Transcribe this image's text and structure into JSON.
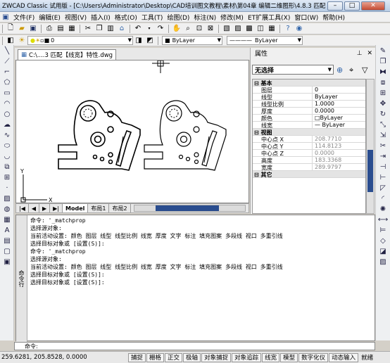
{
  "window": {
    "title": "ZWCAD Classic 试用版 - [C:\\Users\\Administrator\\Desktop\\CAD培训图文教程\\素材\\第04章 编辑二维图形\\4.8.3 匹配【线宽】特性.dwg]",
    "min": "–",
    "max": "□",
    "close": "✕"
  },
  "menu": [
    "文件(F)",
    "编辑(E)",
    "视图(V)",
    "插入(I)",
    "格式(O)",
    "工具(T)",
    "绘图(D)",
    "标注(N)",
    "修改(M)",
    "ET扩展工具(X)",
    "窗口(W)",
    "帮助(H)"
  ],
  "toolbar2": {
    "layer": "0",
    "color": "ByLayer",
    "linetype": "ByLayer"
  },
  "document": {
    "tab_label": "C:\\....3 匹配【线宽】特性.dwg",
    "layout_tabs": [
      "Model",
      "布局1",
      "布局2"
    ]
  },
  "properties": {
    "title": "属性",
    "pin": "⊥",
    "close": "✕",
    "selection": "无选择",
    "rows": [
      {
        "k": "基本",
        "v": "",
        "cat": true
      },
      {
        "k": "图层",
        "v": "0"
      },
      {
        "k": "线型",
        "v": "ByLayer"
      },
      {
        "k": "线型比例",
        "v": "1.0000"
      },
      {
        "k": "厚度",
        "v": "0.0000"
      },
      {
        "k": "颜色",
        "v": "□ByLayer"
      },
      {
        "k": "线宽",
        "v": "— ByLayer"
      },
      {
        "k": "视图",
        "v": "",
        "cat": true
      },
      {
        "k": "中心点 X",
        "v": "208.7710",
        "ro": true
      },
      {
        "k": "中心点 Y",
        "v": "114.8123",
        "ro": true
      },
      {
        "k": "中心点 Z",
        "v": "0.0000",
        "ro": true
      },
      {
        "k": "高度",
        "v": "183.3368",
        "ro": true
      },
      {
        "k": "宽度",
        "v": "289.9797",
        "ro": true
      },
      {
        "k": "其它",
        "v": "",
        "cat": true
      }
    ]
  },
  "command": {
    "side_label": "命令行",
    "lines": [
      "命令: '_matchprop",
      "选择源对象:",
      "当前活动设置: 颜色 图层 线型 线型比例 线宽 厚度 文字 标注 填充图案 多段线 视口 多重引线",
      "选择目标对象或 [设置(S)]:",
      "命令: '_matchprop",
      "选择源对象:",
      "当前活动设置: 颜色 图层 线型 线型比例 线宽 厚度 文字 标注 填充图案 多段线 视口 多重引线",
      "选择目标对象或 [设置(S)]:",
      "选择目标对象或 [设置(S)]:"
    ],
    "prompt": "命令:"
  },
  "status": {
    "coords": "259.6281, 205.8528, 0.0000",
    "buttons": [
      "捕捉",
      "栅格",
      "正交",
      "极轴",
      "对象捕捉",
      "对象追踪",
      "线宽",
      "模型",
      "数字化仪",
      "动态输入",
      "就绪"
    ]
  },
  "colors": {
    "accent": "#2a4d8f",
    "canvas": "#ffffff"
  }
}
